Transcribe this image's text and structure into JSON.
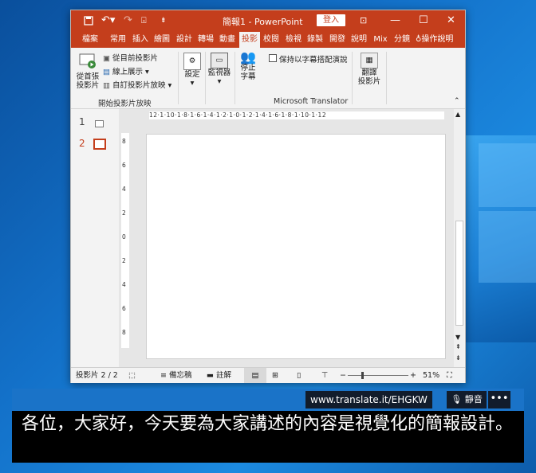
{
  "app": {
    "title": "簡報1 - PowerPoint",
    "signin": "登入",
    "accent": "#c43e1c"
  },
  "tabs": [
    "檔案",
    "常用",
    "插入",
    "繪圖",
    "設計",
    "轉場",
    "動畫",
    "投影",
    "校閱",
    "檢視",
    "錄製",
    "開發",
    "說明",
    "Mix",
    "分鏡"
  ],
  "active_tab": "投影",
  "tell_me": "操作說明",
  "ribbon": {
    "from_beginning": [
      "從首張",
      "投影片"
    ],
    "from_current": "從目前投影片",
    "online_present": "線上展示",
    "custom_show": "自訂投影片放映",
    "group_start": "開始投影片放映",
    "setup": "設定",
    "monitor": "監視器",
    "stop_subtitles": [
      "停止",
      "字幕"
    ],
    "keep_subtitles": "保持以字幕搭配演說",
    "translate_slides": [
      "翻譯",
      "投影片"
    ],
    "group_translator": "Microsoft Translator"
  },
  "thumbnails": [
    {
      "num": "1"
    },
    {
      "num": "2"
    }
  ],
  "ruler": {
    "h_text": "12·1·10·1·8·1·6·1·4·1·2·1·0·1·2·1·4·1·6·1·8·1·10·1·12",
    "v_labels": [
      "8",
      "6",
      "4",
      "2",
      "0",
      "2",
      "4",
      "6",
      "8"
    ]
  },
  "status": {
    "slide_info": "投影片 2 / 2",
    "notes": "備忘稿",
    "comments": "註解",
    "zoom": "51%"
  },
  "caption": {
    "url": "www.translate.it/EHGKW",
    "mute": "靜音",
    "more": "•••",
    "text": "各位，大家好，今天要為大家講述的內容是視覺化的簡報設計。"
  }
}
